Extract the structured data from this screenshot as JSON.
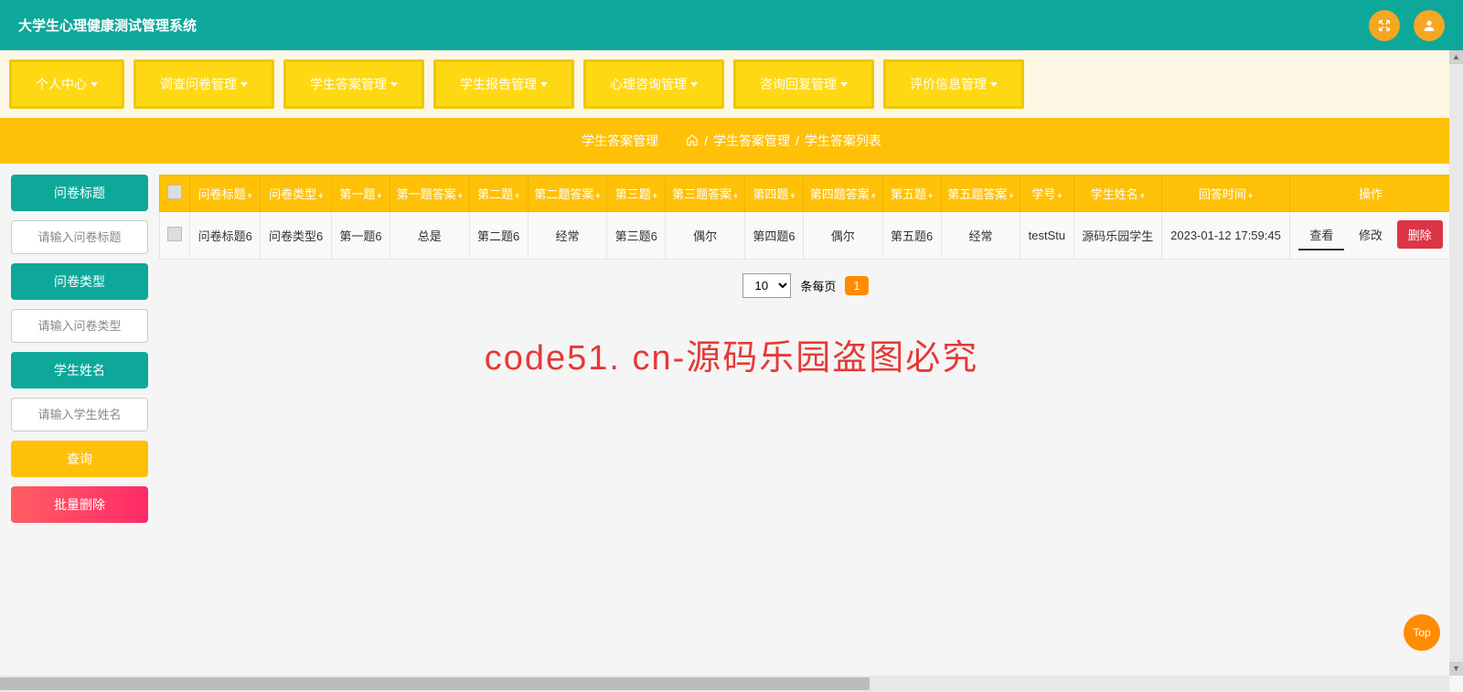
{
  "header": {
    "title": "大学生心理健康测试管理系统"
  },
  "nav": {
    "items": [
      {
        "label": "个人中心"
      },
      {
        "label": "调查问卷管理"
      },
      {
        "label": "学生答案管理"
      },
      {
        "label": "学生报告管理"
      },
      {
        "label": "心理咨询管理"
      },
      {
        "label": "咨询回复管理"
      },
      {
        "label": "评价信息管理"
      }
    ]
  },
  "breadcrumb": {
    "current": "学生答案管理",
    "path1": "学生答案管理",
    "path2": "学生答案列表",
    "sep": "/"
  },
  "sidebar": {
    "label1": "问卷标题",
    "placeholder1": "请输入问卷标题",
    "label2": "问卷类型",
    "placeholder2": "请输入问卷类型",
    "label3": "学生姓名",
    "placeholder3": "请输入学生姓名",
    "query": "查询",
    "batchDelete": "批量删除"
  },
  "table": {
    "headers": [
      "问卷标题",
      "问卷类型",
      "第一题",
      "第一题答案",
      "第二题",
      "第二题答案",
      "第三题",
      "第三题答案",
      "第四题",
      "第四题答案",
      "第五题",
      "第五题答案",
      "学号",
      "学生姓名",
      "回答时间",
      "操作"
    ],
    "rows": [
      {
        "cells": [
          "问卷标题6",
          "问卷类型6",
          "第一题6",
          "总是",
          "第二题6",
          "经常",
          "第三题6",
          "偶尔",
          "第四题6",
          "偶尔",
          "第五题6",
          "经常",
          "testStu",
          "源码乐园学生",
          "2023-01-12 17:59:45"
        ],
        "actions": {
          "view": "查看",
          "edit": "修改",
          "delete": "删除"
        }
      }
    ]
  },
  "pagination": {
    "perPage": "10",
    "perPageLabel": "条每页",
    "current": "1"
  },
  "watermark": "code51. cn-源码乐园盗图必究",
  "topBtn": "Top"
}
